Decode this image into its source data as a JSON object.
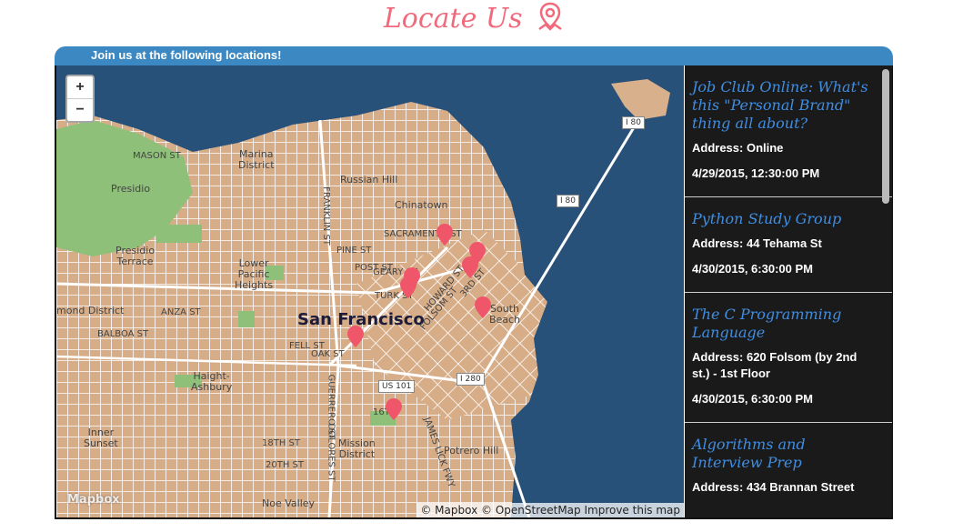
{
  "page": {
    "title": "Locate Us",
    "title_color": "#f06a7c"
  },
  "panel": {
    "header_text": "Join us at the following locations!",
    "header_color": "#3b88c3"
  },
  "map": {
    "zoom_in": "+",
    "zoom_out": "−",
    "attribution": "© Mapbox © OpenStreetMap Improve this map",
    "logo": "Mapbox",
    "water_color": "#28517a",
    "land_color": "#d8b08c",
    "marker_color": "#f0566a",
    "labels": {
      "city": "San Francisco",
      "marina": "Marina\nDistrict",
      "presidio": "Presidio",
      "presidio_terrace": "Presidio\nTerrace",
      "lower_pacific": "Lower\nPacific\nHeights",
      "russian_hill": "Russian Hill",
      "chinatown": "Chinatown",
      "south_beach": "South\nBeach",
      "haight": "Haight-\nAshbury",
      "inner_sunset": "Inner\nSunset",
      "mission": "Mission\nDistrict",
      "potrero": "Potrero Hill",
      "noe": "Noe Valley",
      "richmond": "mond District",
      "mason": "MASON ST",
      "sacramento": "SACRAMENTO ST",
      "pine": "PINE ST",
      "post": "POST ST",
      "geary": "GEARY ST",
      "turk": "TURK ST",
      "anza": "ANZA ST",
      "balboa": "BALBOA ST",
      "fell": "FELL ST",
      "oak": "OAK ST",
      "sixteenth": "16TH",
      "eighteenth": "18TH ST",
      "twentieth": "20TH ST",
      "franklin": "FRANKLIN ST",
      "guerrero": "GUERRERO ST",
      "dolores": "DOLORES ST",
      "folsom": "FOLSOM ST",
      "howard": "HOWARD ST",
      "third": "3RD ST",
      "james_lick": "JAMES LICK FWY"
    },
    "highways": {
      "i80_top": "I 80",
      "i80_mid": "I 80",
      "us101": "US 101",
      "i280": "I 280"
    }
  },
  "events": [
    {
      "title": "Job Club Online: What's this \"Personal Brand\" thing all about?",
      "address": "Address: Online",
      "date": "4/29/2015, 12:30:00 PM"
    },
    {
      "title": "Python Study Group",
      "address": "Address: 44 Tehama St",
      "date": "4/30/2015, 6:30:00 PM"
    },
    {
      "title": "The C Programming Language",
      "address": "Address: 620 Folsom (by 2nd st.) - 1st Floor",
      "date": "4/30/2015, 6:30:00 PM"
    },
    {
      "title": "Algorithms and Interview Prep",
      "address": "Address: 434 Brannan Street",
      "date": ""
    }
  ]
}
